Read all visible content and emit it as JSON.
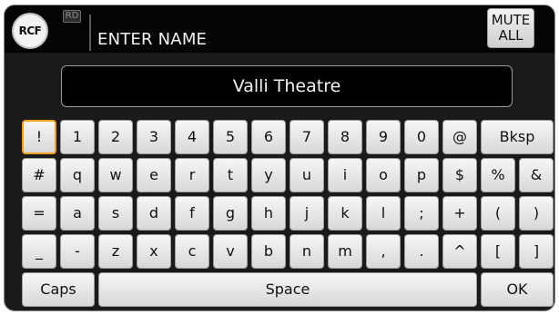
{
  "header": {
    "logo_text": "RCF",
    "badge": "RD",
    "title": "ENTER NAME",
    "mute_line1": "MUTE",
    "mute_line2": "ALL"
  },
  "name_field": {
    "value": "Valli Theatre"
  },
  "keyboard": {
    "focused_key": "!",
    "row1": [
      "!",
      "1",
      "2",
      "3",
      "4",
      "5",
      "6",
      "7",
      "8",
      "9",
      "0",
      "@",
      "Bksp"
    ],
    "row2": [
      "#",
      "q",
      "w",
      "e",
      "r",
      "t",
      "y",
      "u",
      "i",
      "o",
      "p",
      "$",
      "%",
      "&"
    ],
    "row3": [
      "=",
      "a",
      "s",
      "d",
      "f",
      "g",
      "h",
      "j",
      "k",
      "l",
      ";",
      "+",
      "(",
      ")"
    ],
    "row4": [
      "_",
      "-",
      "z",
      "x",
      "c",
      "v",
      "b",
      "n",
      "m",
      ",",
      ".",
      "^",
      "[",
      "]"
    ],
    "row5": [
      "Caps",
      "Space",
      "OK"
    ]
  },
  "colors": {
    "background": "#1a1a1a",
    "header": "#050505",
    "key_face": "#e6e6e6",
    "focus_outline": "#f0a020"
  }
}
